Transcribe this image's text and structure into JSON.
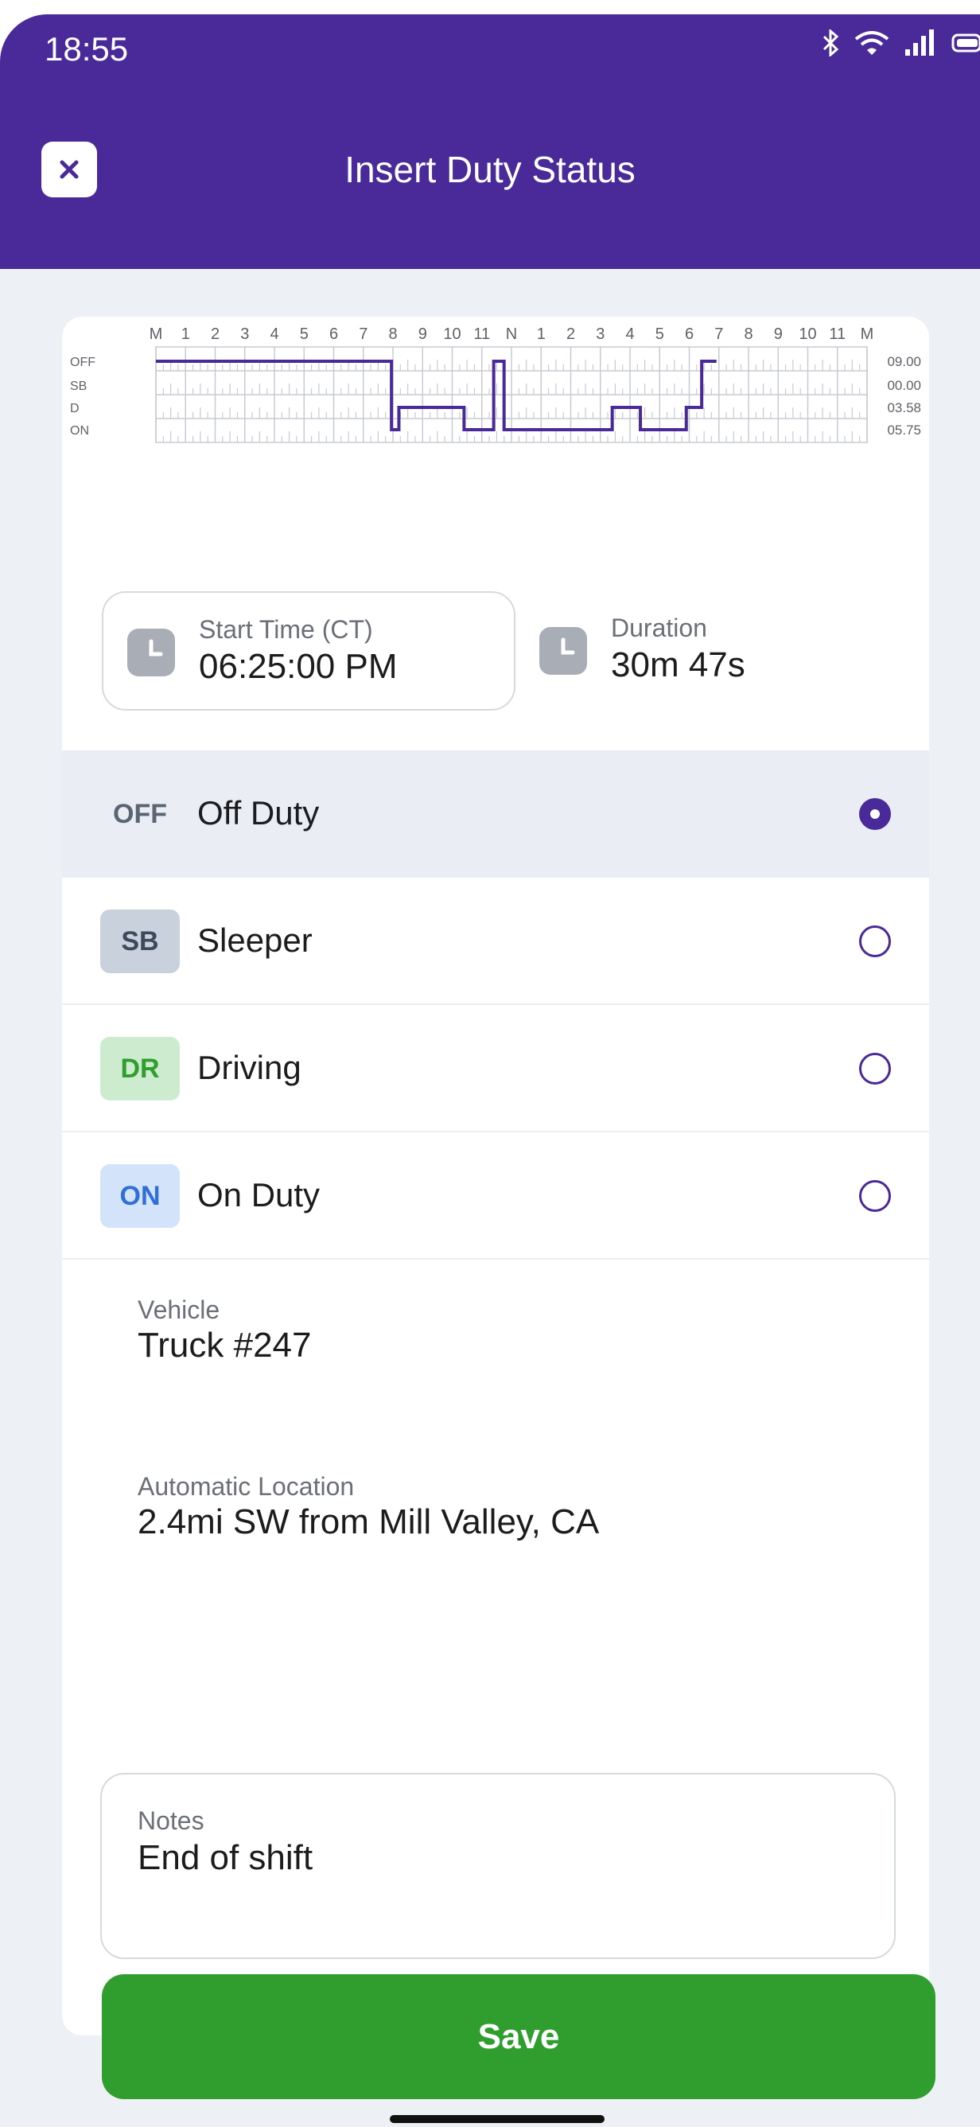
{
  "status_bar": {
    "time": "18:55",
    "icons": [
      "bluetooth-icon",
      "wifi-icon",
      "signal-icon",
      "battery-icon"
    ]
  },
  "header": {
    "title": "Insert Duty Status",
    "close_icon": "close-icon",
    "background": "#4a2a98"
  },
  "chart": {
    "hour_labels": [
      "M",
      "1",
      "2",
      "3",
      "4",
      "5",
      "6",
      "7",
      "8",
      "9",
      "10",
      "11",
      "N",
      "1",
      "2",
      "3",
      "4",
      "5",
      "6",
      "7",
      "8",
      "9",
      "10",
      "11",
      "M"
    ],
    "row_labels": [
      "OFF",
      "SB",
      "D",
      "ON"
    ],
    "totals": [
      "09.00",
      "00.00",
      "03.58",
      "05.75"
    ],
    "line_color": "#4a2a98"
  },
  "chart_data": {
    "type": "line",
    "title": "",
    "xlabel": "",
    "ylabel": "",
    "xlim": [
      0,
      24
    ],
    "categories_y": [
      "OFF",
      "SB",
      "D",
      "ON"
    ],
    "segments": [
      {
        "status": "OFF",
        "from": 0,
        "to": 7.95
      },
      {
        "status": "ON",
        "from": 7.95,
        "to": 8.2
      },
      {
        "status": "D",
        "from": 8.2,
        "to": 10.4
      },
      {
        "status": "ON",
        "from": 10.4,
        "to": 11.4
      },
      {
        "status": "OFF",
        "from": 11.4,
        "to": 11.75
      },
      {
        "status": "ON",
        "from": 11.75,
        "to": 15.4
      },
      {
        "status": "D",
        "from": 15.4,
        "to": 16.35
      },
      {
        "status": "ON",
        "from": 16.35,
        "to": 17.9
      },
      {
        "status": "D",
        "from": 17.9,
        "to": 18.42
      },
      {
        "status": "OFF",
        "from": 18.42,
        "to": 18.92
      }
    ],
    "totals": {
      "OFF": "09.00",
      "SB": "00.00",
      "D": "03.58",
      "ON": "05.75"
    }
  },
  "start_time": {
    "label": "Start Time (CT)",
    "value": "06:25:00 PM",
    "icon": "clock-icon"
  },
  "duration": {
    "label": "Duration",
    "value": "30m 47s",
    "icon": "clock-icon"
  },
  "statuses": [
    {
      "code": "OFF",
      "label": "Off Duty",
      "selected": true,
      "badge_bg": "#eaeef4",
      "badge_fg": "#5a6472"
    },
    {
      "code": "SB",
      "label": "Sleeper",
      "selected": false,
      "badge_bg": "#c9d1dd",
      "badge_fg": "#3d4a5c"
    },
    {
      "code": "DR",
      "label": "Driving",
      "selected": false,
      "badge_bg": "#cdeccf",
      "badge_fg": "#2f9e2f"
    },
    {
      "code": "ON",
      "label": "On Duty",
      "selected": false,
      "badge_bg": "#d3e3fa",
      "badge_fg": "#2f6fd6"
    }
  ],
  "vehicle": {
    "label": "Vehicle",
    "value": "Truck #247"
  },
  "location": {
    "label": "Automatic Location",
    "value": "2.4mi SW from Mill Valley, CA"
  },
  "notes": {
    "label": "Notes",
    "value": "End of shift"
  },
  "save_label": "Save",
  "colors": {
    "accent": "#4a2a98",
    "save": "#2f9e2f"
  }
}
